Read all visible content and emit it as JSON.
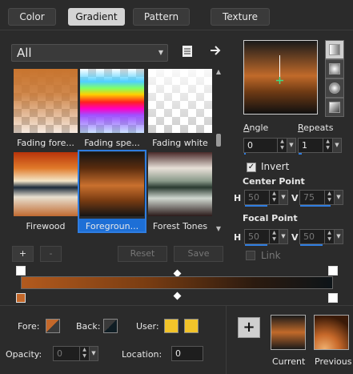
{
  "tabs": [
    {
      "label": "Color"
    },
    {
      "label": "Gradient"
    },
    {
      "label": "Pattern"
    },
    {
      "label": "Texture"
    }
  ],
  "category_select": {
    "value": "All"
  },
  "gradients": [
    {
      "label": "Fading fore..."
    },
    {
      "label": "Fading spe..."
    },
    {
      "label": "Fading white"
    },
    {
      "label": "Firewood"
    },
    {
      "label": "Foregroun...",
      "selected": true
    },
    {
      "label": "Forest Tones"
    }
  ],
  "gradient_buttons": {
    "add": "+",
    "remove": "-",
    "reset": "Reset",
    "save": "Save"
  },
  "angle": {
    "label": "Angle",
    "value": "0"
  },
  "repeats": {
    "label": "Repeats",
    "value": "1"
  },
  "invert": {
    "label": "Invert",
    "checked": true
  },
  "center_point": {
    "label": "Center Point",
    "h_label": "H",
    "h_value": "50",
    "v_label": "V",
    "v_value": "75"
  },
  "focal_point": {
    "label": "Focal Point",
    "h_label": "H",
    "h_value": "50",
    "v_label": "V",
    "v_value": "50"
  },
  "link": {
    "label": "Link",
    "checked": false
  },
  "fore": {
    "label": "Fore:",
    "color": "#c4682a"
  },
  "back": {
    "label": "Back:",
    "color": "#0f1d24"
  },
  "user": {
    "label": "User:",
    "colors": [
      "#f2c42a",
      "#f2c42a"
    ]
  },
  "opacity": {
    "label": "Opacity:",
    "value": "0"
  },
  "location": {
    "label": "Location:",
    "value": "0"
  },
  "current": {
    "label": "Current"
  },
  "previous": {
    "label": "Previous"
  },
  "colors": {
    "accent": "#2f7de0",
    "panel": "#2b2b2b"
  }
}
